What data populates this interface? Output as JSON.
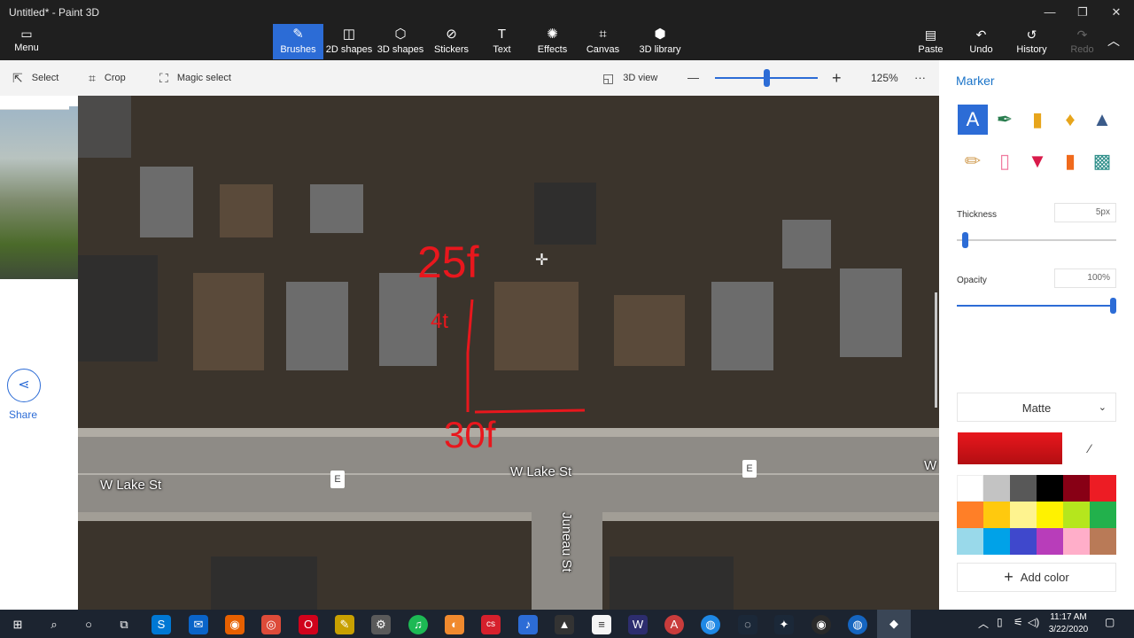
{
  "window": {
    "title": "Untitled* - Paint 3D",
    "minimize_glyph": "—",
    "restore_glyph": "❐",
    "close_glyph": "✕"
  },
  "menu": {
    "label": "Menu",
    "icon": "folder-icon",
    "glyph": "▭"
  },
  "ribbon": {
    "tools": [
      {
        "label": "Brushes",
        "icon": "brush-icon",
        "glyph": "✎",
        "active": true
      },
      {
        "label": "2D shapes",
        "icon": "2d-shapes-icon",
        "glyph": "◫",
        "active": false
      },
      {
        "label": "3D shapes",
        "icon": "3d-shapes-icon",
        "glyph": "⬡",
        "active": false
      },
      {
        "label": "Stickers",
        "icon": "stickers-icon",
        "glyph": "⊘",
        "active": false
      },
      {
        "label": "Text",
        "icon": "text-icon",
        "glyph": "T",
        "active": false
      },
      {
        "label": "Effects",
        "icon": "effects-icon",
        "glyph": "✺",
        "active": false
      },
      {
        "label": "Canvas",
        "icon": "canvas-icon",
        "glyph": "⌗",
        "active": false
      },
      {
        "label": "3D library",
        "icon": "3d-library-icon",
        "glyph": "⬢",
        "active": false
      }
    ],
    "right": [
      {
        "label": "Paste",
        "icon": "paste-icon",
        "glyph": "▤",
        "enabled": true
      },
      {
        "label": "Undo",
        "icon": "undo-icon",
        "glyph": "↶",
        "enabled": true
      },
      {
        "label": "History",
        "icon": "history-icon",
        "glyph": "↺",
        "enabled": true
      },
      {
        "label": "Redo",
        "icon": "redo-icon",
        "glyph": "↷",
        "enabled": false
      }
    ],
    "collapse_glyph": "︿"
  },
  "toolbar": {
    "select": "Select",
    "select_glyph": "⇱",
    "crop": "Crop",
    "crop_glyph": "⌗",
    "magic_select": "Magic select",
    "magic_glyph": "⛶",
    "view_3d": "3D view",
    "view_glyph": "◱",
    "zoom_out_glyph": "—",
    "zoom_in_glyph": "+",
    "zoom": "125%",
    "more_glyph": "···"
  },
  "canvas": {
    "share_label": "Share",
    "share_glyph": "⋖",
    "street_labels": [
      "W Lake St",
      "W Lake St",
      "Juneau St",
      "W"
    ],
    "e_marker": "E",
    "annotations": [
      "25f",
      "4t",
      "30f"
    ],
    "annotation_color": "#e8171d",
    "cursor_glyph": "✛"
  },
  "panel": {
    "title": "Marker",
    "brushes": [
      {
        "icon": "marker-brush-icon",
        "glyph": "A",
        "selected": true
      },
      {
        "icon": "calligraphy-pen-icon",
        "glyph": "✒",
        "selected": false
      },
      {
        "icon": "oil-brush-icon",
        "glyph": "▮",
        "selected": false
      },
      {
        "icon": "watercolor-icon",
        "glyph": "♦",
        "selected": false
      },
      {
        "icon": "pixel-pen-icon",
        "glyph": "▲",
        "selected": false
      },
      {
        "icon": "pencil-icon",
        "glyph": "✏",
        "selected": false
      },
      {
        "icon": "eraser-icon",
        "glyph": "▯",
        "selected": false
      },
      {
        "icon": "crayon-icon",
        "glyph": "▼",
        "selected": false
      },
      {
        "icon": "spray-can-icon",
        "glyph": "▮",
        "selected": false
      },
      {
        "icon": "fill-icon",
        "glyph": "▩",
        "selected": false
      }
    ],
    "thickness_label": "Thickness",
    "thickness_value": "5px",
    "thickness_fraction": 0.04,
    "opacity_label": "Opacity",
    "opacity_value": "100%",
    "opacity_fraction": 1.0,
    "finish": "Matte",
    "finish_chevron": "⌄",
    "current_color": "#e8171d",
    "eyedropper_glyph": "⁄",
    "palette": [
      "#ffffff",
      "#c3c3c3",
      "#585858",
      "#000000",
      "#880015",
      "#ed1c24",
      "#ff7f27",
      "#ffc90e",
      "#fef38f",
      "#fff200",
      "#b5e61d",
      "#22b14c",
      "#99d9ea",
      "#00a2e8",
      "#3f48cc",
      "#b83dba",
      "#ffaec9",
      "#b97a57"
    ],
    "add_color": "Add color",
    "add_glyph": "+"
  },
  "taskbar": {
    "icons": [
      {
        "icon": "windows-start-icon",
        "color": "#1c2430",
        "glyph": "⊞"
      },
      {
        "icon": "search-icon",
        "color": "#1c2430",
        "glyph": "⌕"
      },
      {
        "icon": "cortana-icon",
        "color": "#1c2430",
        "glyph": "○"
      },
      {
        "icon": "task-view-icon",
        "color": "#1c2430",
        "glyph": "⧉"
      },
      {
        "icon": "skype-icon",
        "color": "#0078d4",
        "glyph": "S"
      },
      {
        "icon": "mail-icon",
        "color": "#0a64c8",
        "glyph": "✉"
      },
      {
        "icon": "firefox-icon",
        "color": "#e66000",
        "glyph": "◉"
      },
      {
        "icon": "chrome-icon",
        "color": "#dd4b39",
        "glyph": "◎"
      },
      {
        "icon": "opera-icon",
        "color": "#d0021b",
        "glyph": "O"
      },
      {
        "icon": "pen-app-icon",
        "color": "#c8a000",
        "glyph": "✎"
      },
      {
        "icon": "steam-like-icon",
        "color": "#5a5a5a",
        "glyph": "⚙"
      },
      {
        "icon": "spotify-icon",
        "color": "#1db954",
        "glyph": "♫"
      },
      {
        "icon": "fruit-app-icon",
        "color": "#f08a2e",
        "glyph": "◐"
      },
      {
        "icon": "cs-app-icon",
        "color": "#d6202c",
        "glyph": "cs"
      },
      {
        "icon": "musescore-icon",
        "color": "#2c6cd6",
        "glyph": "♪"
      },
      {
        "icon": "inkscape-icon",
        "color": "#333333",
        "glyph": "▲"
      },
      {
        "icon": "notepad-icon",
        "color": "#f5f5f5",
        "glyph": "≡"
      },
      {
        "icon": "winamp-icon",
        "color": "#2d2d6e",
        "glyph": "W"
      },
      {
        "icon": "acrobat-icon",
        "color": "#c93c3c",
        "glyph": "A"
      },
      {
        "icon": "globe-icon",
        "color": "#1e88e5",
        "glyph": "◍"
      },
      {
        "icon": "steam-icon",
        "color": "#1b2838",
        "glyph": "◌"
      },
      {
        "icon": "stars-app-icon",
        "color": "#1b2838",
        "glyph": "✦"
      },
      {
        "icon": "obs-icon",
        "color": "#2a2a2a",
        "glyph": "◉"
      },
      {
        "icon": "browser-icon",
        "color": "#1565c0",
        "glyph": "◍"
      },
      {
        "icon": "paint-3d-icon",
        "color": "#5a86e8",
        "glyph": "◆"
      }
    ],
    "tray": [
      "︿",
      "▯",
      "⚟",
      "◁)",
      "⌨"
    ],
    "time": "11:17 AM",
    "date": "3/22/2020",
    "notification_glyph": "▢"
  }
}
